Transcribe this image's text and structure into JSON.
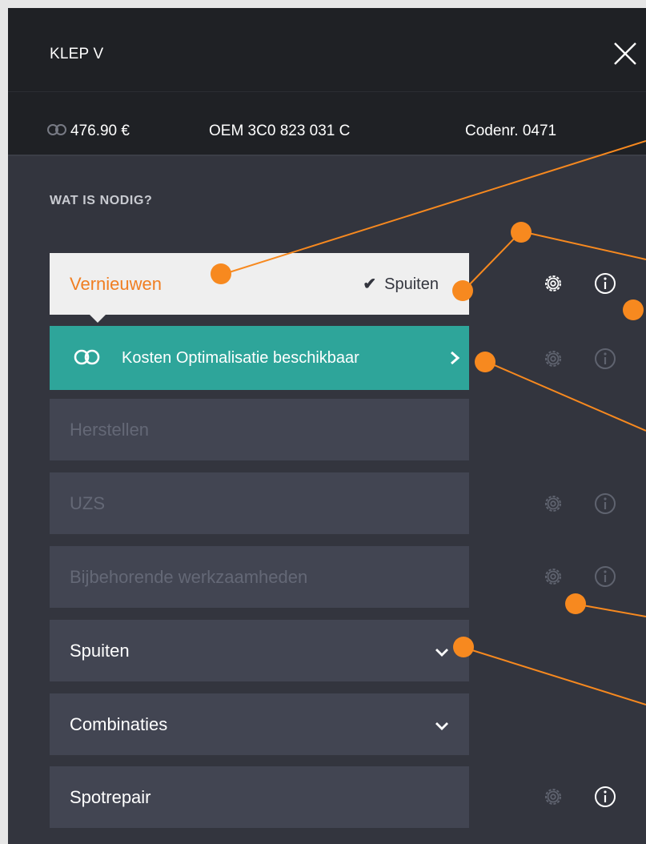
{
  "header": {
    "title": "KLEP V",
    "close_icon": "close-icon"
  },
  "infobar": {
    "price": "476.90 €",
    "oem": "OEM 3C0 823 031 C",
    "code": "Codenr. 0471"
  },
  "section": {
    "label": "WAT IS NODIG?"
  },
  "rows": {
    "vernieuwen": {
      "label": "Vernieuwen",
      "status": "Spuiten"
    },
    "promo": {
      "label": "Kosten Optimalisatie beschikbaar"
    },
    "herstellen": {
      "label": "Herstellen"
    },
    "uzs": {
      "label": "UZS"
    },
    "bijbehorende": {
      "label": "Bijbehorende werkzaamheden"
    },
    "spuiten": {
      "label": "Spuiten"
    },
    "combinaties": {
      "label": "Combinaties"
    },
    "spotrepair": {
      "label": "Spotrepair"
    }
  },
  "colors": {
    "accent": "#f07e22",
    "annotation": "#f7891f",
    "promo": "#2ea59a",
    "panel": "#33353e",
    "header": "#1f2125",
    "row": "#424552"
  }
}
